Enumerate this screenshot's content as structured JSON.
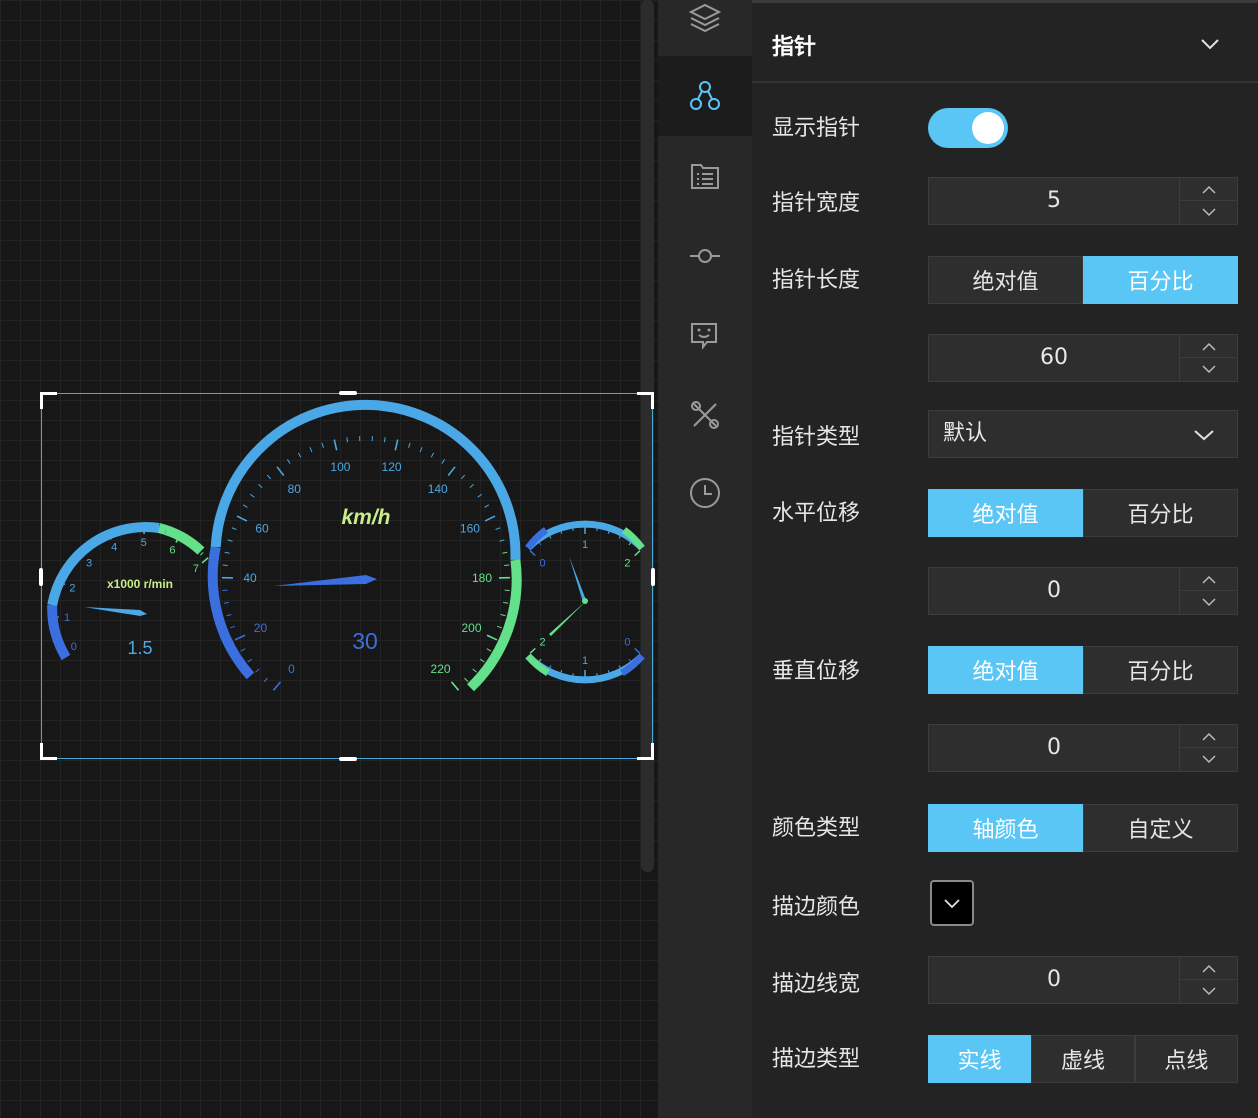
{
  "canvas": {
    "gauges": {
      "speed": {
        "unit": "km/h",
        "value": 30,
        "value_text": "30",
        "tick_labels": [
          "0",
          "20",
          "40",
          "60",
          "80",
          "100",
          "120",
          "140",
          "160",
          "180",
          "200",
          "220"
        ]
      },
      "rpm": {
        "unit": "x1000 r/min",
        "value": 1.5,
        "value_text": "1.5",
        "tick_labels": [
          "0",
          "1",
          "2",
          "3",
          "4",
          "5",
          "6",
          "7"
        ]
      },
      "aux": {
        "upper_tick_labels": [
          "0",
          "1",
          "2"
        ],
        "lower_tick_labels": [
          "2",
          "1",
          "0"
        ]
      }
    }
  },
  "sidebar": {
    "items": [
      {
        "icon": "layers-icon",
        "active": false
      },
      {
        "icon": "nodes-icon",
        "active": true
      },
      {
        "icon": "list-doc-icon",
        "active": false
      },
      {
        "icon": "commit-icon",
        "active": false
      },
      {
        "icon": "chat-bot-icon",
        "active": false
      },
      {
        "icon": "tools-icon",
        "active": false
      },
      {
        "icon": "clock-icon",
        "active": false
      }
    ]
  },
  "panel": {
    "title": "指针",
    "show_pointer": {
      "label": "显示指针",
      "value": true
    },
    "pointer_width": {
      "label": "指针宽度",
      "value": "5"
    },
    "pointer_length": {
      "label": "指针长度",
      "options": [
        "绝对值",
        "百分比"
      ],
      "selected": "百分比",
      "value": "60"
    },
    "pointer_type": {
      "label": "指针类型",
      "value": "默认"
    },
    "h_offset": {
      "label": "水平位移",
      "options": [
        "绝对值",
        "百分比"
      ],
      "selected": "绝对值",
      "value": "0"
    },
    "v_offset": {
      "label": "垂直位移",
      "options": [
        "绝对值",
        "百分比"
      ],
      "selected": "绝对值",
      "value": "0"
    },
    "color_type": {
      "label": "颜色类型",
      "options": [
        "轴颜色",
        "自定义"
      ],
      "selected": "轴颜色"
    },
    "stroke_color": {
      "label": "描边颜色",
      "value": "#000000"
    },
    "stroke_width": {
      "label": "描边线宽",
      "value": "0"
    },
    "stroke_type": {
      "label": "描边类型",
      "options": [
        "实线",
        "虚线",
        "点线"
      ],
      "selected": "实线"
    }
  },
  "colors": {
    "accent": "#5ac6f5",
    "gauge_blue": "#3b6fe0",
    "gauge_cyan": "#4aa8e6",
    "gauge_green": "#63e08a",
    "gauge_yellow": "#c8ee8a"
  }
}
